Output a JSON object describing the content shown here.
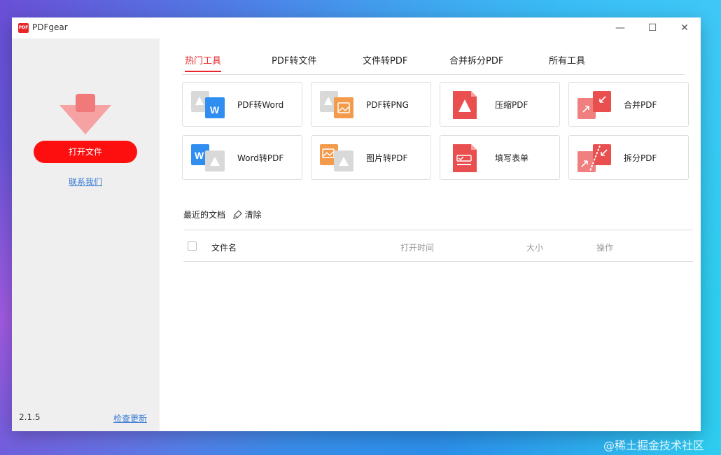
{
  "app": {
    "title": "PDFgear",
    "logo_text": "PDF"
  },
  "window_controls": {
    "minimize": "—",
    "maximize": "☐",
    "close": "✕"
  },
  "sidebar": {
    "open_file_label": "打开文件",
    "contact_label": "联系我们",
    "version": "2.1.5",
    "check_update_label": "检查更新"
  },
  "tabs": [
    {
      "label": "热门工具",
      "active": true
    },
    {
      "label": "PDF转文件",
      "active": false
    },
    {
      "label": "文件转PDF",
      "active": false
    },
    {
      "label": "合并拆分PDF",
      "active": false
    },
    {
      "label": "所有工具",
      "active": false
    }
  ],
  "tools": [
    {
      "label": "PDF转Word",
      "icon": "pdf-to-word-icon"
    },
    {
      "label": "PDF转PNG",
      "icon": "pdf-to-png-icon"
    },
    {
      "label": "压缩PDF",
      "icon": "compress-pdf-icon"
    },
    {
      "label": "合并PDF",
      "icon": "merge-pdf-icon"
    },
    {
      "label": "Word转PDF",
      "icon": "word-to-pdf-icon"
    },
    {
      "label": "图片转PDF",
      "icon": "image-to-pdf-icon"
    },
    {
      "label": "填写表单",
      "icon": "fill-form-icon"
    },
    {
      "label": "拆分PDF",
      "icon": "split-pdf-icon"
    }
  ],
  "recent": {
    "title": "最近的文档",
    "clear_label": "清除",
    "columns": [
      "文件名",
      "打开时间",
      "大小",
      "操作"
    ]
  },
  "watermark": "@稀土掘金技术社区",
  "colors": {
    "accent": "#fe0f0f",
    "tab_active": "#e8262c",
    "pdf_gray": "#d9d9d9",
    "word_blue": "#2f8ef0",
    "image_orange": "#f39a4b",
    "pdf_red": "#ea4f4f",
    "link_blue": "#3a7bd5"
  }
}
